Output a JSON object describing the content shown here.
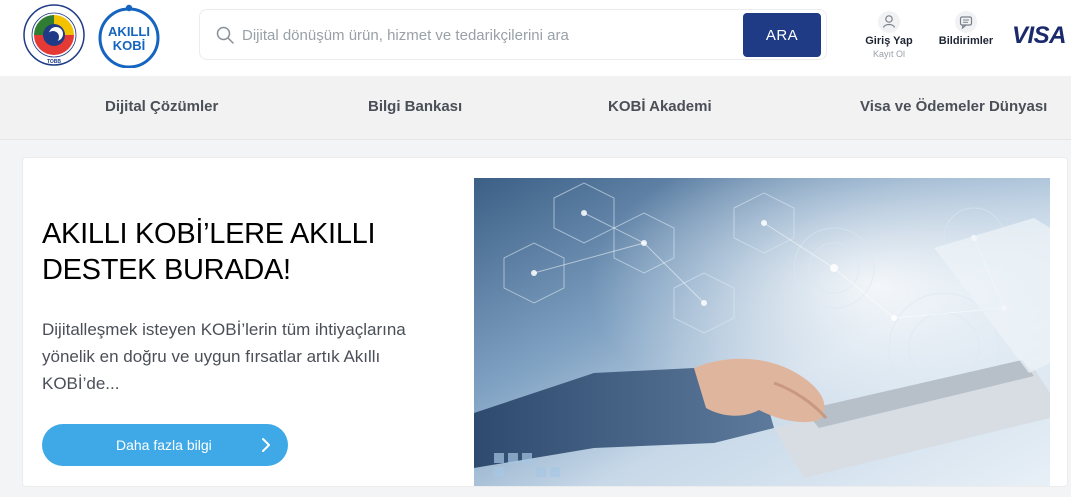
{
  "header": {
    "tobb_logo": {
      "text": "TÜRKİYE ODALAR VE BORSALAR BİRLİĞİ",
      "short": "TOBB"
    },
    "kobi_logo": {
      "line1": "AKILLI",
      "line2": "KOBİ"
    },
    "search": {
      "placeholder": "Dijital dönüşüm ürün, hizmet ve tedarikçilerini ara",
      "button_label": "ARA"
    },
    "login": {
      "label": "Giriş Yap",
      "sub": "Kayıt Ol",
      "icon": "user-icon"
    },
    "notifications": {
      "label": "Bildirimler",
      "icon": "chat-bubble-icon"
    },
    "partner_logo": "VISA"
  },
  "nav": {
    "items": [
      {
        "label": "Dijital Çözümler"
      },
      {
        "label": "Bilgi Bankası"
      },
      {
        "label": "KOBİ Akademi"
      },
      {
        "label": "Visa ve Ödemeler Dünyası"
      }
    ]
  },
  "hero": {
    "title": "AKILLI KOBİ’LERE AKILLI DESTEK BURADA!",
    "description": "Dijitalleşmek isteyen KOBİ’lerin tüm ihtiyaçlarına yönelik en doğru ve uygun fırsatlar artık Akıllı KOBİ’de...",
    "cta_label": "Daha fazla bilgi",
    "image_alt": "hand-on-laptop-with-digital-network-overlay"
  },
  "colors": {
    "primary_navy": "#1f3b86",
    "cta_blue": "#3ea9e6",
    "kobi_blue": "#1565c0",
    "visa_navy": "#1a2a6c",
    "nav_bg": "#f2f2f2"
  }
}
